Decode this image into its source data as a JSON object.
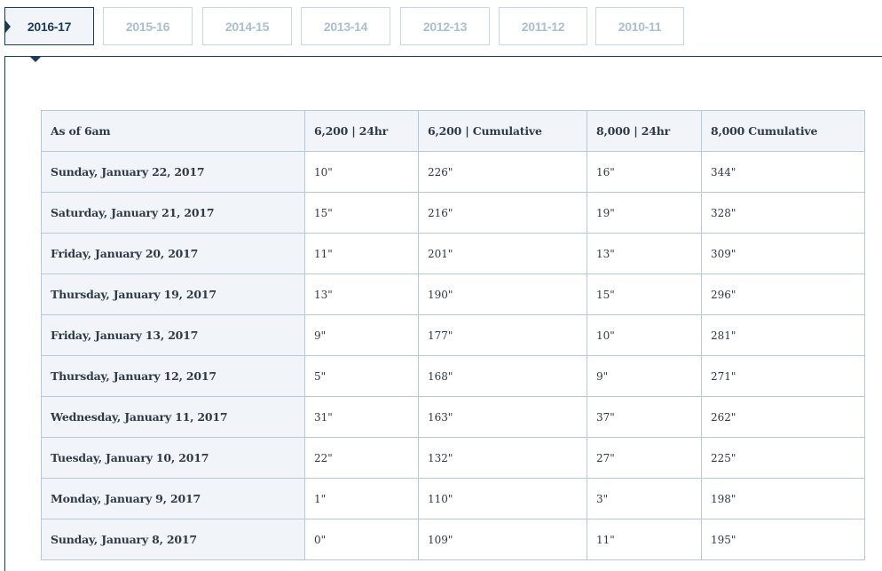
{
  "tabs": [
    {
      "label": "2016-17",
      "active": true
    },
    {
      "label": "2015-16",
      "active": false
    },
    {
      "label": "2014-15",
      "active": false
    },
    {
      "label": "2013-14",
      "active": false
    },
    {
      "label": "2012-13",
      "active": false
    },
    {
      "label": "2011-12",
      "active": false
    },
    {
      "label": "2010-11",
      "active": false
    }
  ],
  "table": {
    "headers": [
      "As of 6am",
      "6,200 | 24hr",
      "6,200 | Cumulative",
      "8,000 | 24hr",
      "8,000 Cumulative"
    ],
    "rows": [
      {
        "date": "Sunday, January 22, 2017",
        "v1": "10\"",
        "v2": "226\"",
        "v3": "16\"",
        "v4": "344\""
      },
      {
        "date": "Saturday, January 21, 2017",
        "v1": "15\"",
        "v2": "216\"",
        "v3": "19\"",
        "v4": "328\""
      },
      {
        "date": "Friday, January 20, 2017",
        "v1": "11\"",
        "v2": "201\"",
        "v3": "13\"",
        "v4": "309\""
      },
      {
        "date": "Thursday, January 19, 2017",
        "v1": "13\"",
        "v2": "190\"",
        "v3": "15\"",
        "v4": "296\""
      },
      {
        "date": "Friday, January 13, 2017",
        "v1": "9\"",
        "v2": "177\"",
        "v3": "10\"",
        "v4": "281\""
      },
      {
        "date": "Thursday, January 12, 2017",
        "v1": "5\"",
        "v2": "168\"",
        "v3": "9\"",
        "v4": "271\""
      },
      {
        "date": "Wednesday, January 11, 2017",
        "v1": "31\"",
        "v2": "163\"",
        "v3": "37\"",
        "v4": "262\""
      },
      {
        "date": "Tuesday, January 10, 2017",
        "v1": "22\"",
        "v2": "132\"",
        "v3": "27\"",
        "v4": "225\""
      },
      {
        "date": "Monday, January 9, 2017",
        "v1": "1\"",
        "v2": "110\"",
        "v3": "3\"",
        "v4": "198\""
      },
      {
        "date": "Sunday, January 8, 2017",
        "v1": "0\"",
        "v2": "109\"",
        "v3": "11\"",
        "v4": "195\""
      }
    ]
  },
  "colors": {
    "accent": "#1d3a5c",
    "inactive_tab_text": "#a9bfd3",
    "cell_border": "#b5cad9",
    "header_bg": "#f1f5f9"
  }
}
